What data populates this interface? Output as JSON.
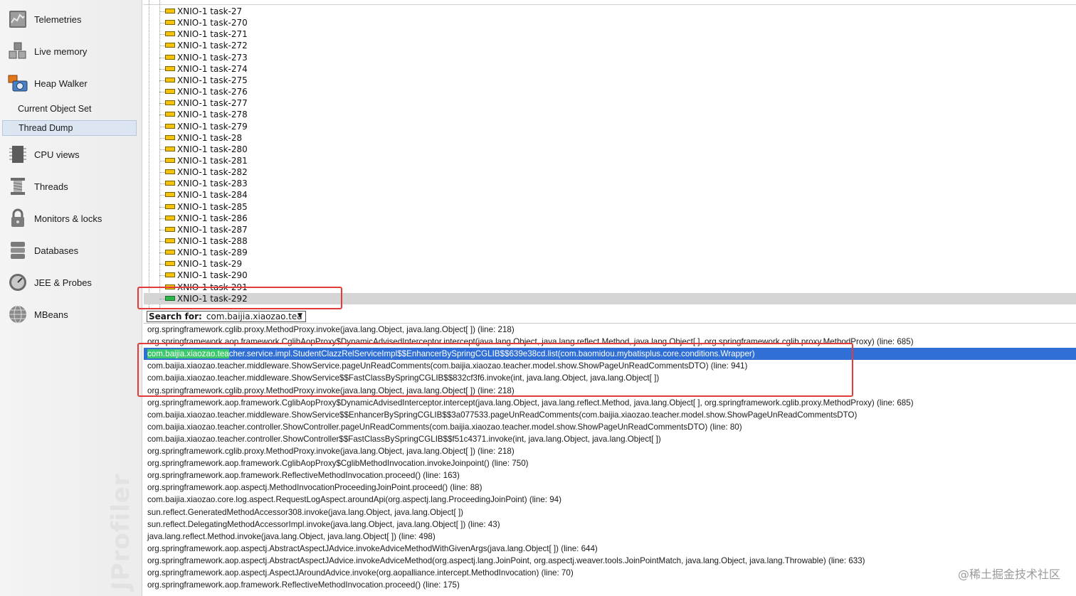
{
  "sidebar": {
    "brand_watermark": "JProfiler",
    "items": [
      {
        "label": "Telemetries",
        "icon": "telemetries-icon"
      },
      {
        "label": "Live memory",
        "icon": "live-memory-icon"
      },
      {
        "label": "Heap Walker",
        "icon": "heap-walker-icon"
      },
      {
        "label": "CPU views",
        "icon": "cpu-views-icon"
      },
      {
        "label": "Threads",
        "icon": "threads-icon"
      },
      {
        "label": "Monitors & locks",
        "icon": "monitors-locks-icon"
      },
      {
        "label": "Databases",
        "icon": "databases-icon"
      },
      {
        "label": "JEE & Probes",
        "icon": "jee-probes-icon"
      },
      {
        "label": "MBeans",
        "icon": "mbeans-icon"
      }
    ],
    "subitems": [
      {
        "label": "Current Object Set",
        "selected": false
      },
      {
        "label": "Thread Dump",
        "selected": true
      }
    ]
  },
  "thread_tree": {
    "threads": [
      {
        "name": "XNIO-1 task-27",
        "state": "waiting"
      },
      {
        "name": "XNIO-1 task-270",
        "state": "waiting"
      },
      {
        "name": "XNIO-1 task-271",
        "state": "waiting"
      },
      {
        "name": "XNIO-1 task-272",
        "state": "waiting"
      },
      {
        "name": "XNIO-1 task-273",
        "state": "waiting"
      },
      {
        "name": "XNIO-1 task-274",
        "state": "waiting"
      },
      {
        "name": "XNIO-1 task-275",
        "state": "waiting"
      },
      {
        "name": "XNIO-1 task-276",
        "state": "waiting"
      },
      {
        "name": "XNIO-1 task-277",
        "state": "waiting"
      },
      {
        "name": "XNIO-1 task-278",
        "state": "waiting"
      },
      {
        "name": "XNIO-1 task-279",
        "state": "waiting"
      },
      {
        "name": "XNIO-1 task-28",
        "state": "waiting"
      },
      {
        "name": "XNIO-1 task-280",
        "state": "waiting"
      },
      {
        "name": "XNIO-1 task-281",
        "state": "waiting"
      },
      {
        "name": "XNIO-1 task-282",
        "state": "waiting"
      },
      {
        "name": "XNIO-1 task-283",
        "state": "waiting"
      },
      {
        "name": "XNIO-1 task-284",
        "state": "waiting"
      },
      {
        "name": "XNIO-1 task-285",
        "state": "waiting"
      },
      {
        "name": "XNIO-1 task-286",
        "state": "waiting"
      },
      {
        "name": "XNIO-1 task-287",
        "state": "waiting"
      },
      {
        "name": "XNIO-1 task-288",
        "state": "waiting"
      },
      {
        "name": "XNIO-1 task-289",
        "state": "waiting"
      },
      {
        "name": "XNIO-1 task-29",
        "state": "waiting"
      },
      {
        "name": "XNIO-1 task-290",
        "state": "waiting"
      },
      {
        "name": "XNIO-1 task-291",
        "state": "waiting"
      },
      {
        "name": "XNIO-1 task-292",
        "state": "running",
        "selected": true
      }
    ],
    "state_colors": {
      "waiting": "#f2c20c",
      "running": "#2fb64b"
    }
  },
  "search": {
    "label": "Search for:",
    "value": "com.baijia.xiaozao.tea"
  },
  "stack": {
    "highlight_match": "com.baijia.xiaozao.tea",
    "frames": [
      {
        "text": "org.springframework.cglib.proxy.MethodProxy.invoke(java.lang.Object, java.lang.Object[ ]) (line: 218)"
      },
      {
        "text": "org.springframework.aop.framework.CglibAopProxy$DynamicAdvisedInterceptor.intercept(java.lang.Object, java.lang.reflect.Method, java.lang.Object[ ], org.springframework.cglib.proxy.MethodProxy) (line: 685)"
      },
      {
        "text": "com.baijia.xiaozao.teacher.service.impl.StudentClazzRelServiceImpl$$EnhancerBySpringCGLIB$$639e38cd.list(com.baomidou.mybatisplus.core.conditions.Wrapper)",
        "selected": true
      },
      {
        "text": "com.baijia.xiaozao.teacher.middleware.ShowService.pageUnReadComments(com.baijia.xiaozao.teacher.model.show.ShowPageUnReadCommentsDTO) (line: 941)"
      },
      {
        "text": "com.baijia.xiaozao.teacher.middleware.ShowService$$FastClassBySpringCGLIB$$832cf3f6.invoke(int, java.lang.Object, java.lang.Object[ ])"
      },
      {
        "text": "org.springframework.cglib.proxy.MethodProxy.invoke(java.lang.Object, java.lang.Object[ ]) (line: 218)"
      },
      {
        "text": "org.springframework.aop.framework.CglibAopProxy$DynamicAdvisedInterceptor.intercept(java.lang.Object, java.lang.reflect.Method, java.lang.Object[ ], org.springframework.cglib.proxy.MethodProxy) (line: 685)"
      },
      {
        "text": "com.baijia.xiaozao.teacher.middleware.ShowService$$EnhancerBySpringCGLIB$$3a077533.pageUnReadComments(com.baijia.xiaozao.teacher.model.show.ShowPageUnReadCommentsDTO)"
      },
      {
        "text": "com.baijia.xiaozao.teacher.controller.ShowController.pageUnReadComments(com.baijia.xiaozao.teacher.model.show.ShowPageUnReadCommentsDTO) (line: 80)"
      },
      {
        "text": "com.baijia.xiaozao.teacher.controller.ShowController$$FastClassBySpringCGLIB$$f51c4371.invoke(int, java.lang.Object, java.lang.Object[ ])"
      },
      {
        "text": "org.springframework.cglib.proxy.MethodProxy.invoke(java.lang.Object, java.lang.Object[ ]) (line: 218)"
      },
      {
        "text": "org.springframework.aop.framework.CglibAopProxy$CglibMethodInvocation.invokeJoinpoint() (line: 750)"
      },
      {
        "text": "org.springframework.aop.framework.ReflectiveMethodInvocation.proceed() (line: 163)"
      },
      {
        "text": "org.springframework.aop.aspectj.MethodInvocationProceedingJoinPoint.proceed() (line: 88)"
      },
      {
        "text": "com.baijia.xiaozao.core.log.aspect.RequestLogAspect.aroundApi(org.aspectj.lang.ProceedingJoinPoint) (line: 94)"
      },
      {
        "text": "sun.reflect.GeneratedMethodAccessor308.invoke(java.lang.Object, java.lang.Object[ ])"
      },
      {
        "text": "sun.reflect.DelegatingMethodAccessorImpl.invoke(java.lang.Object, java.lang.Object[ ]) (line: 43)"
      },
      {
        "text": "java.lang.reflect.Method.invoke(java.lang.Object, java.lang.Object[ ]) (line: 498)"
      },
      {
        "text": "org.springframework.aop.aspectj.AbstractAspectJAdvice.invokeAdviceMethodWithGivenArgs(java.lang.Object[ ]) (line: 644)"
      },
      {
        "text": "org.springframework.aop.aspectj.AbstractAspectJAdvice.invokeAdviceMethod(org.aspectj.lang.JoinPoint, org.aspectj.weaver.tools.JoinPointMatch, java.lang.Object, java.lang.Throwable) (line: 633)"
      },
      {
        "text": "org.springframework.aop.aspectj.AspectJAroundAdvice.invoke(org.aopalliance.intercept.MethodInvocation) (line: 70)"
      },
      {
        "text": "org.springframework.aop.framework.ReflectiveMethodInvocation.proceed() (line: 175)"
      }
    ]
  },
  "watermark": "@稀土掘金技术社区",
  "colors": {
    "selection_blue": "#2f6fd6",
    "search_match_green": "#3cc96a",
    "annotation_red": "#e23b3b"
  }
}
